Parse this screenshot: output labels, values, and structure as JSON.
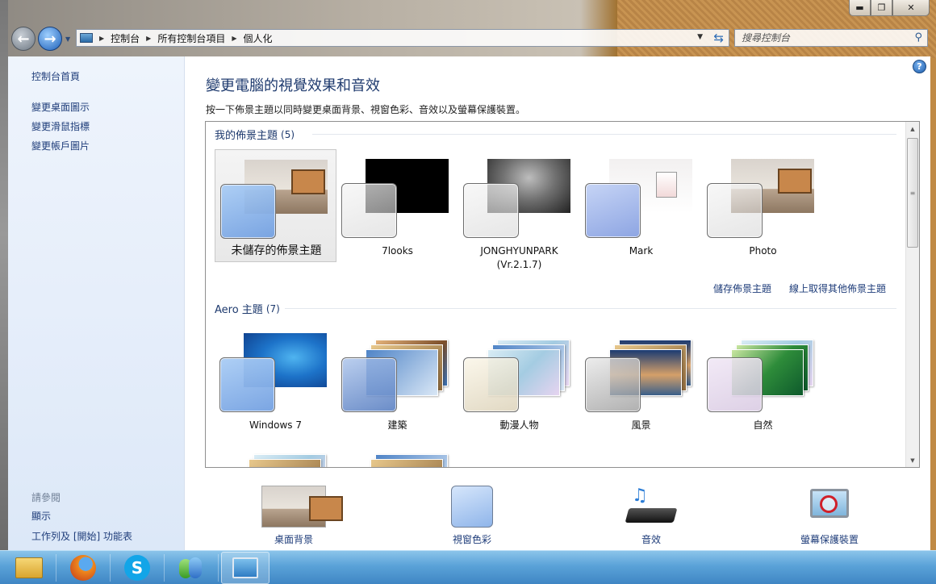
{
  "window": {
    "controls": {
      "minimize": "▬",
      "maximize": "❐",
      "close": "✕"
    }
  },
  "nav": {
    "breadcrumb": [
      "控制台",
      "所有控制台項目",
      "個人化"
    ],
    "search_placeholder": "搜尋控制台"
  },
  "sidebar": {
    "home": "控制台首頁",
    "links": [
      "變更桌面圖示",
      "變更滑鼠指標",
      "變更帳戶圖片"
    ],
    "see_also_heading": "請參閱",
    "see_also": [
      "顯示",
      "工作列及 [開始] 功能表"
    ]
  },
  "main": {
    "title": "變更電腦的視覺效果和音效",
    "subtitle": "按一下佈景主題以同時變更桌面背景、視窗色彩、音效以及螢幕保護裝置。",
    "my_themes": {
      "heading": "我的佈景主題",
      "count": "(5)",
      "items": [
        {
          "label": "未儲存的佈景主題",
          "bg": "room",
          "swatch": "sky",
          "selected": true
        },
        {
          "label": "7looks",
          "bg": "black",
          "swatch": "clear"
        },
        {
          "label": "JONGHYUNPARK",
          "label2": "(Vr.2.1.7)",
          "bg": "grey",
          "swatch": "clear"
        },
        {
          "label": "Mark",
          "bg": "mark",
          "swatch": "periw"
        },
        {
          "label": "Photo",
          "bg": "room",
          "swatch": "clear"
        }
      ],
      "save_link": "儲存佈景主題",
      "online_link": "線上取得其他佈景主題"
    },
    "aero_themes": {
      "heading": "Aero 主題",
      "count": "(7)",
      "items": [
        {
          "label": "Windows 7",
          "bg": "win7",
          "swatch": "sky"
        },
        {
          "label": "建築",
          "bg": "arch",
          "swatch": "arch"
        },
        {
          "label": "動漫人物",
          "bg": "char",
          "swatch": "char"
        },
        {
          "label": "風景",
          "bg": "land",
          "swatch": "land"
        },
        {
          "label": "自然",
          "bg": "nat",
          "swatch": "nat"
        }
      ]
    },
    "bottom": [
      {
        "label": "桌面背景",
        "icon": "desktop-background-icon"
      },
      {
        "label": "視窗色彩",
        "icon": "window-color-icon"
      },
      {
        "label": "音效",
        "icon": "sounds-icon"
      },
      {
        "label": "螢幕保護裝置",
        "icon": "screensaver-icon"
      }
    ]
  },
  "taskbar": {
    "items": [
      "windows-explorer-icon",
      "firefox-icon",
      "skype-icon",
      "messenger-icon",
      "control-panel-icon"
    ]
  }
}
